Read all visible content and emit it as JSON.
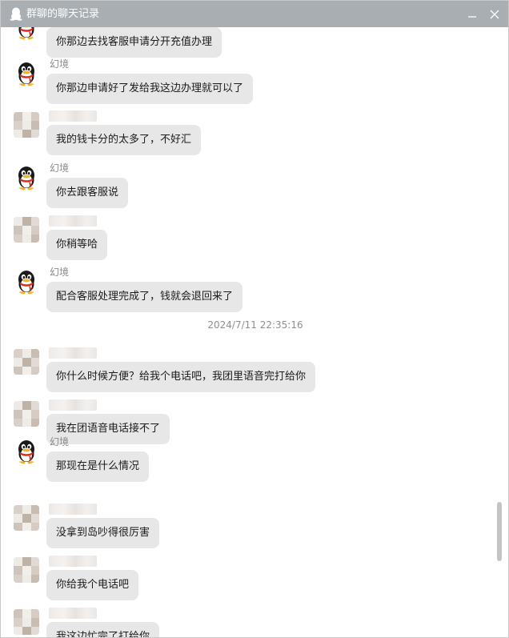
{
  "window": {
    "title": "群聊的聊天记录",
    "minimize_icon": "minimize-icon",
    "close_icon": "close-icon"
  },
  "messages": [
    {
      "sender": "",
      "avatar": "qq-penguin-partial",
      "text": "你那边去找客服申请分开充值办理"
    },
    {
      "sender": "幻境",
      "avatar": "qq-penguin",
      "text": "你那边申请好了发给我这边办理就可以了"
    },
    {
      "sender": "",
      "avatar": "blurred",
      "text": "我的钱卡分的太多了，不好汇"
    },
    {
      "sender": "幻境",
      "avatar": "qq-penguin",
      "text": "你去跟客服说"
    },
    {
      "sender": "",
      "avatar": "blurred",
      "text": "你稍等哈"
    },
    {
      "sender": "幻境",
      "avatar": "qq-penguin",
      "text": "配合客服处理完成了，钱就会退回来了"
    },
    {
      "sender": "",
      "avatar": "blurred",
      "text": "你什么时候方便？给我个电话吧，我团里语音完打给你"
    },
    {
      "sender": "",
      "avatar": "blurred",
      "text": "我在团语音电话接不了"
    },
    {
      "sender": "幻境",
      "avatar": "qq-penguin",
      "text": "那现在是什么情况"
    },
    {
      "sender": "",
      "avatar": "blurred",
      "text": "没拿到岛吵得很厉害"
    },
    {
      "sender": "",
      "avatar": "blurred",
      "text": "你给我个电话吧"
    },
    {
      "sender": "",
      "avatar": "blurred",
      "text": "我这边忙完了打给你"
    }
  ],
  "timestamp": "2024/7/11 22:35:16",
  "colors": {
    "titlebar": "#a9aeb3",
    "bubble": "#e7e7e7",
    "text": "#1b1b1b",
    "name": "#8a8a8a"
  }
}
